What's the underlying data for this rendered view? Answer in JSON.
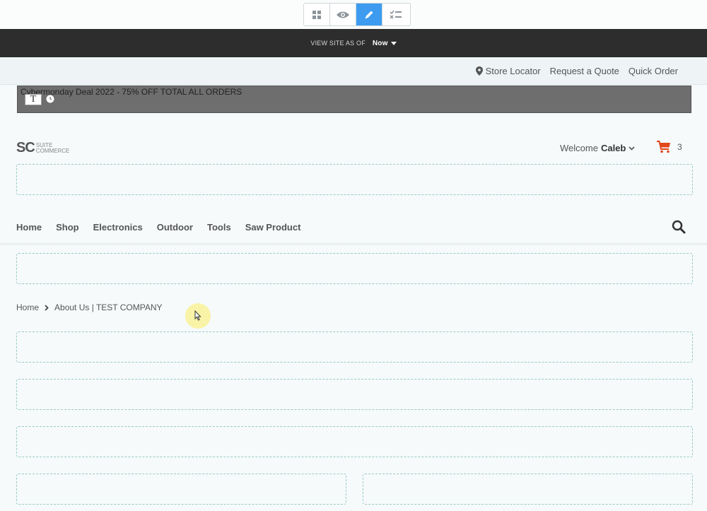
{
  "view_bar": {
    "label": "VIEW SITE AS OF",
    "value": "Now"
  },
  "utility_links": [
    {
      "label": "Store Locator"
    },
    {
      "label": "Request a Quote"
    },
    {
      "label": "Quick Order"
    }
  ],
  "promo": {
    "text": "Cybermonday Deal 2022 - 75% OFF TOTAL ALL ORDERS",
    "badge": "T"
  },
  "logo": {
    "mark": "SC",
    "line1": "SUITE",
    "line2": "COMMERCE"
  },
  "header": {
    "welcome": "Welcome",
    "user": "Caleb",
    "cart_count": "3"
  },
  "nav": [
    {
      "label": "Home"
    },
    {
      "label": "Shop"
    },
    {
      "label": "Electronics"
    },
    {
      "label": "Outdoor"
    },
    {
      "label": "Tools"
    },
    {
      "label": "Saw Product"
    }
  ],
  "breadcrumb": {
    "home": "Home",
    "current": "About Us | TEST COMPANY"
  },
  "colors": {
    "active_mode": "#3e9cf0",
    "cart": "#e2471a",
    "dash": "#9bc9c4"
  },
  "icons": [
    "grid-icon",
    "eye-icon",
    "pencil-icon",
    "checklist-icon",
    "map-pin-icon",
    "clock-icon",
    "chevron-down-icon",
    "cart-icon",
    "search-icon",
    "cursor-icon"
  ]
}
